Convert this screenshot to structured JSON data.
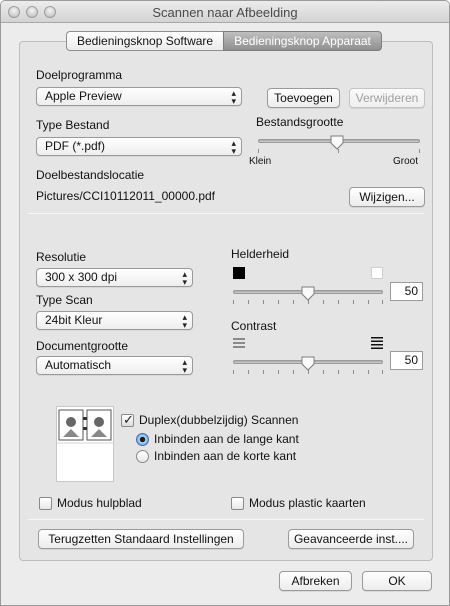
{
  "window": {
    "title": "Scannen naar Afbeelding"
  },
  "tabs": [
    {
      "label": "Bedieningsknop Software",
      "active": false
    },
    {
      "label": "Bedieningsknop Apparaat",
      "active": true
    }
  ],
  "target": {
    "label": "Doelprogramma",
    "value": "Apple Preview",
    "add_label": "Toevoegen",
    "remove_label": "Verwijderen"
  },
  "filetype": {
    "label": "Type Bestand",
    "value": "PDF (*.pdf)"
  },
  "filesize": {
    "label": "Bestandsgrootte",
    "min_label": "Klein",
    "max_label": "Groot",
    "level": 0.45
  },
  "destination": {
    "label": "Doelbestandslocatie",
    "path": "Pictures/CCI10112011_00000.pdf",
    "change_label": "Wijzigen..."
  },
  "resolution": {
    "label": "Resolutie",
    "value": "300 x 300 dpi"
  },
  "scantype": {
    "label": "Type Scan",
    "value": "24bit Kleur"
  },
  "docsize": {
    "label": "Documentgrootte",
    "value": "Automatisch"
  },
  "brightness": {
    "label": "Helderheid",
    "value": "50",
    "level": 0.5,
    "dark_color": "#000000",
    "light_color": "#ffffff"
  },
  "contrast": {
    "label": "Contrast",
    "value": "50",
    "level": 0.5
  },
  "duplex": {
    "label": "Duplex(dubbelzijdig) Scannen",
    "checked": true,
    "long_edge_label": "Inbinden aan de lange kant",
    "short_edge_label": "Inbinden aan de korte kant",
    "selected": "long"
  },
  "carrier_sheet": {
    "label": "Modus hulpblad",
    "checked": false
  },
  "plastic_card": {
    "label": "Modus plastic kaarten",
    "checked": false
  },
  "buttons": {
    "restore_defaults": "Terugzetten Standaard Instellingen",
    "advanced": "Geavanceerde inst....",
    "cancel": "Afbreken",
    "ok": "OK"
  },
  "colors": {
    "accent": "#5a9be8",
    "tab_active": "#9a9a9a",
    "panel": "#e5e5e5"
  }
}
